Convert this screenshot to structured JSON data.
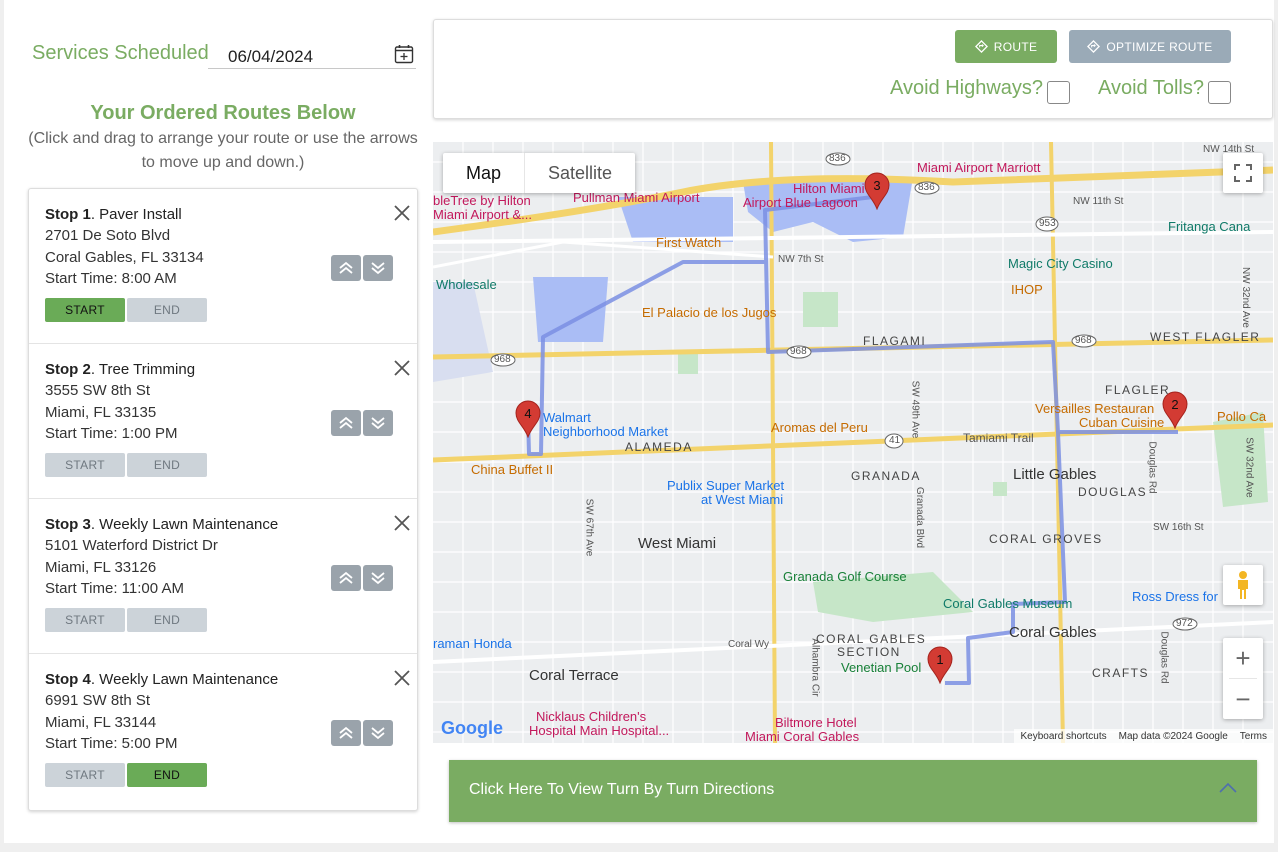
{
  "header": {
    "services_label": "Services Scheduled",
    "date_value": "06/04/2024"
  },
  "routes": {
    "title": "Your Ordered Routes Below",
    "help": "(Click and drag to arrange your route or use the arrows to move up and down.)"
  },
  "stops": [
    {
      "prefix": "Stop 1",
      "name": ". Paver Install",
      "street": "2701 De Soto Blvd",
      "city": "Coral Gables, FL 33134",
      "time": "Start Time: 8:00 AM",
      "start_label": "START",
      "end_label": "END",
      "start_active": true,
      "end_active": false
    },
    {
      "prefix": "Stop 2",
      "name": ". Tree Trimming",
      "street": "3555 SW 8th St",
      "city": "Miami, FL 33135",
      "time": "Start Time: 1:00 PM",
      "start_label": "START",
      "end_label": "END",
      "start_active": false,
      "end_active": false
    },
    {
      "prefix": "Stop 3",
      "name": ". Weekly Lawn Maintenance",
      "street": "5101 Waterford District Dr",
      "city": "Miami, FL 33126",
      "time": "Start Time: 11:00 AM",
      "start_label": "START",
      "end_label": "END",
      "start_active": false,
      "end_active": false
    },
    {
      "prefix": "Stop 4",
      "name": ". Weekly Lawn Maintenance",
      "street": "6991 SW 8th St",
      "city": "Miami, FL 33144",
      "time": "Start Time: 5:00 PM",
      "start_label": "START",
      "end_label": "END",
      "start_active": false,
      "end_active": true
    }
  ],
  "toolbar": {
    "route_label": "ROUTE",
    "optimize_label": "OPTIMIZE ROUTE",
    "avoid_highways_label": "Avoid Highways?",
    "avoid_tolls_label": "Avoid Tolls?",
    "avoid_highways_checked": false,
    "avoid_tolls_checked": false
  },
  "map": {
    "type_map": "Map",
    "type_satellite": "Satellite",
    "google": "Google",
    "footer": {
      "shortcuts": "Keyboard shortcuts",
      "data": "Map data ©2024 Google",
      "terms": "Terms"
    },
    "zoom_in": "+",
    "zoom_out": "−",
    "pins": [
      "1",
      "2",
      "3",
      "4"
    ],
    "labels": {
      "hilton": "Hilton Miami",
      "hilton2": "Airport Blue Lagoon",
      "marriott": "Miami Airport Marriott",
      "doubletree": "bleTree by Hilton",
      "doubletree2": "Miami Airport &...",
      "pullman": "Pullman Miami Airport",
      "first_watch": "First Watch",
      "fritanga": "Fritanga Cana",
      "magic_city": "Magic City Casino",
      "ihop": "IHOP",
      "wholesale": "Wholesale",
      "palacio": "El Palacio de los Jugos",
      "flagami": "FLAGAMI",
      "west_flagler": "WEST FLAGLER",
      "flagler": "FLAGLER",
      "versailles": "Versailles Restauran",
      "versailles2": "Cuban Cuisine",
      "pollo": "Pollo Ca",
      "walmart": "Walmart",
      "walmart2": "Neighborhood Market",
      "alameda": "ALAMEDA",
      "aromas": "Aromas del Peru",
      "tamiami": "Tamiami Trail",
      "china_buffet": "China Buffet II",
      "granada": "GRANADA",
      "little_gables": "Little Gables",
      "douglas": "DOUGLAS",
      "publix": "Publix Super Market",
      "publix2": "at West Miami",
      "west_miami": "West Miami",
      "coral_groves": "CORAL GROVES",
      "granada_golf": "Granada Golf Course",
      "cg_museum": "Coral Gables Museum",
      "ross": "Ross Dress for",
      "coral_gables": "Coral Gables",
      "graman": "raman Honda",
      "cg_section": "CORAL GABLES",
      "cg_section2": "SECTION",
      "venetian": "Venetian Pool",
      "coral_terrace": "Coral Terrace",
      "crafts": "CRAFTS",
      "nicklaus": "Nicklaus Children's",
      "nicklaus2": "Hospital Main Hospital...",
      "biltmore": "Biltmore Hotel",
      "biltmore2": "Miami Coral Gables",
      "nw14": "NW 14th St",
      "nw11": "NW 11th St",
      "nw7": "NW 7th St",
      "sw16": "SW 16th St",
      "coral_wy": "Coral Wy",
      "r836a": "836",
      "r836b": "836",
      "r953": "953",
      "r968a": "968",
      "r968b": "968",
      "r968c": "968",
      "r41": "41",
      "r972": "972",
      "sw67": "SW 67th Ave",
      "sw49": "SW 49th Ave",
      "granada_blvd": "Granada Blvd",
      "alhambra": "Alhambra Cir",
      "douglas_rd": "Douglas Rd",
      "douglas_rd2": "Douglas Rd",
      "nw32": "NW 32nd Ave",
      "sw32": "SW 32nd Ave"
    }
  },
  "directions": {
    "label": "Click Here To View Turn By Turn Directions"
  },
  "colors": {
    "brand_green": "#7aac62",
    "active_button": "#6aab57",
    "optimize_button": "#9aaab7",
    "route_line": "#7b8fe3",
    "pin_red": "#d33b33"
  }
}
